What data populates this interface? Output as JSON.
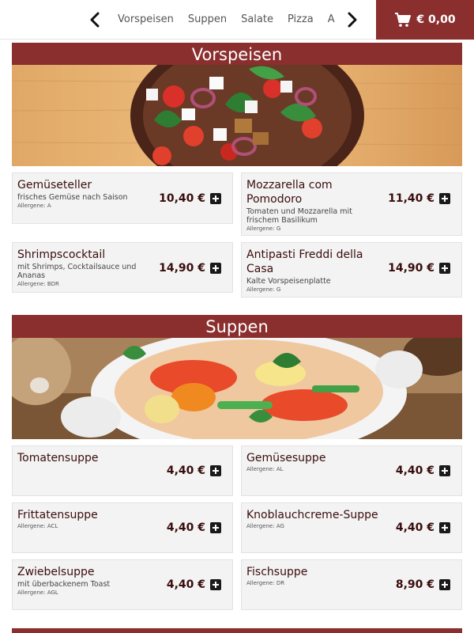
{
  "nav": {
    "prev_icon": "chevron-left-icon",
    "next_icon": "chevron-right-icon",
    "items": [
      "Vorspeisen",
      "Suppen",
      "Salate",
      "Pizza",
      "A"
    ]
  },
  "cart": {
    "icon": "shopping-cart-icon",
    "total": "€ 0,00"
  },
  "colors": {
    "accent": "#8b2e2e",
    "card_bg": "#f3f3f3",
    "text": "#3a0d0d"
  },
  "sections": [
    {
      "title": "Vorspeisen",
      "items": [
        {
          "name": "Gemüseteller",
          "description": "frisches Gemüse nach Saison",
          "allergens": "Allergene: A",
          "price": "10,40 €"
        },
        {
          "name": "Mozzarella com Pomodoro",
          "description": "Tomaten und Mozzarella mit frischem Basilikum",
          "allergens": "Allergene: G",
          "price": "11,40 €"
        },
        {
          "name": "Shrimpscocktail",
          "description": "mit Shrimps, Cocktailsauce und Ananas",
          "allergens": "Allergene: BDR",
          "price": "14,90 €"
        },
        {
          "name": "Antipasti Freddi della Casa",
          "description": "Kalte Vorspeisenplatte",
          "allergens": "Allergene: G",
          "price": "14,90 €"
        }
      ]
    },
    {
      "title": "Suppen",
      "items": [
        {
          "name": "Tomatensuppe",
          "description": "",
          "allergens": "",
          "price": "4,40 €"
        },
        {
          "name": "Gemüsesuppe",
          "description": "",
          "allergens": "Allergene: AL",
          "price": "4,40 €"
        },
        {
          "name": "Frittatensuppe",
          "description": "",
          "allergens": "Allergene: ACL",
          "price": "4,40 €"
        },
        {
          "name": "Knoblauchcreme-Suppe",
          "description": "",
          "allergens": "Allergene: AG",
          "price": "4,40 €"
        },
        {
          "name": "Zwiebelsuppe",
          "description": "mit überbackenem Toast",
          "allergens": "Allergene: AGL",
          "price": "4,40 €"
        },
        {
          "name": "Fischsuppe",
          "description": "",
          "allergens": "Allergene: DR",
          "price": "8,90 €"
        }
      ]
    }
  ]
}
